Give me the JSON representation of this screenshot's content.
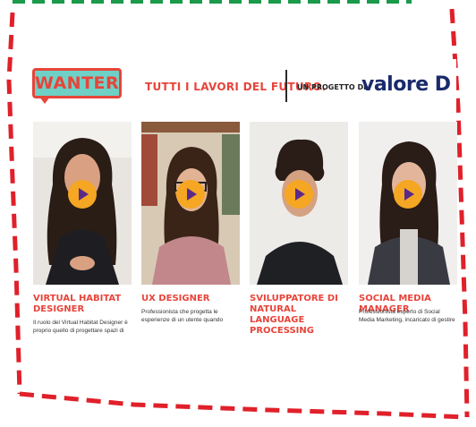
{
  "header": {
    "logo_text": "WANTER",
    "tagline": "TUTTI I LAVORI DEL FUTURO.",
    "project_prefix": "UN PROGETTO DI",
    "partner_logo": "valore D"
  },
  "videos": [
    {
      "title": "VIRTUAL HABITAT DESIGNER",
      "description": "Il ruolo del Virtual Habitat Designer è proprio quello di progettare spazi di"
    },
    {
      "title": "UX DESIGNER",
      "description": "Professionista che progetta le esperienze di un utente quando interagisce con un'app, un sito web, un"
    },
    {
      "title": "SVILUPPATORE DI NATURAL LANGUAGE PROCESSING",
      "description": ""
    },
    {
      "title": "SOCIAL MEDIA MANAGER",
      "description": "Professionista esperto di Social Media Marketing, incaricato di gestire la comunicazione di un brand o azienda"
    }
  ],
  "colors": {
    "brand_red": "#e8443a",
    "brand_teal": "#6fd0c6",
    "play_orange": "#f5a623",
    "frame_dash": "#e0202a",
    "top_dash": "#1a9a4a"
  }
}
